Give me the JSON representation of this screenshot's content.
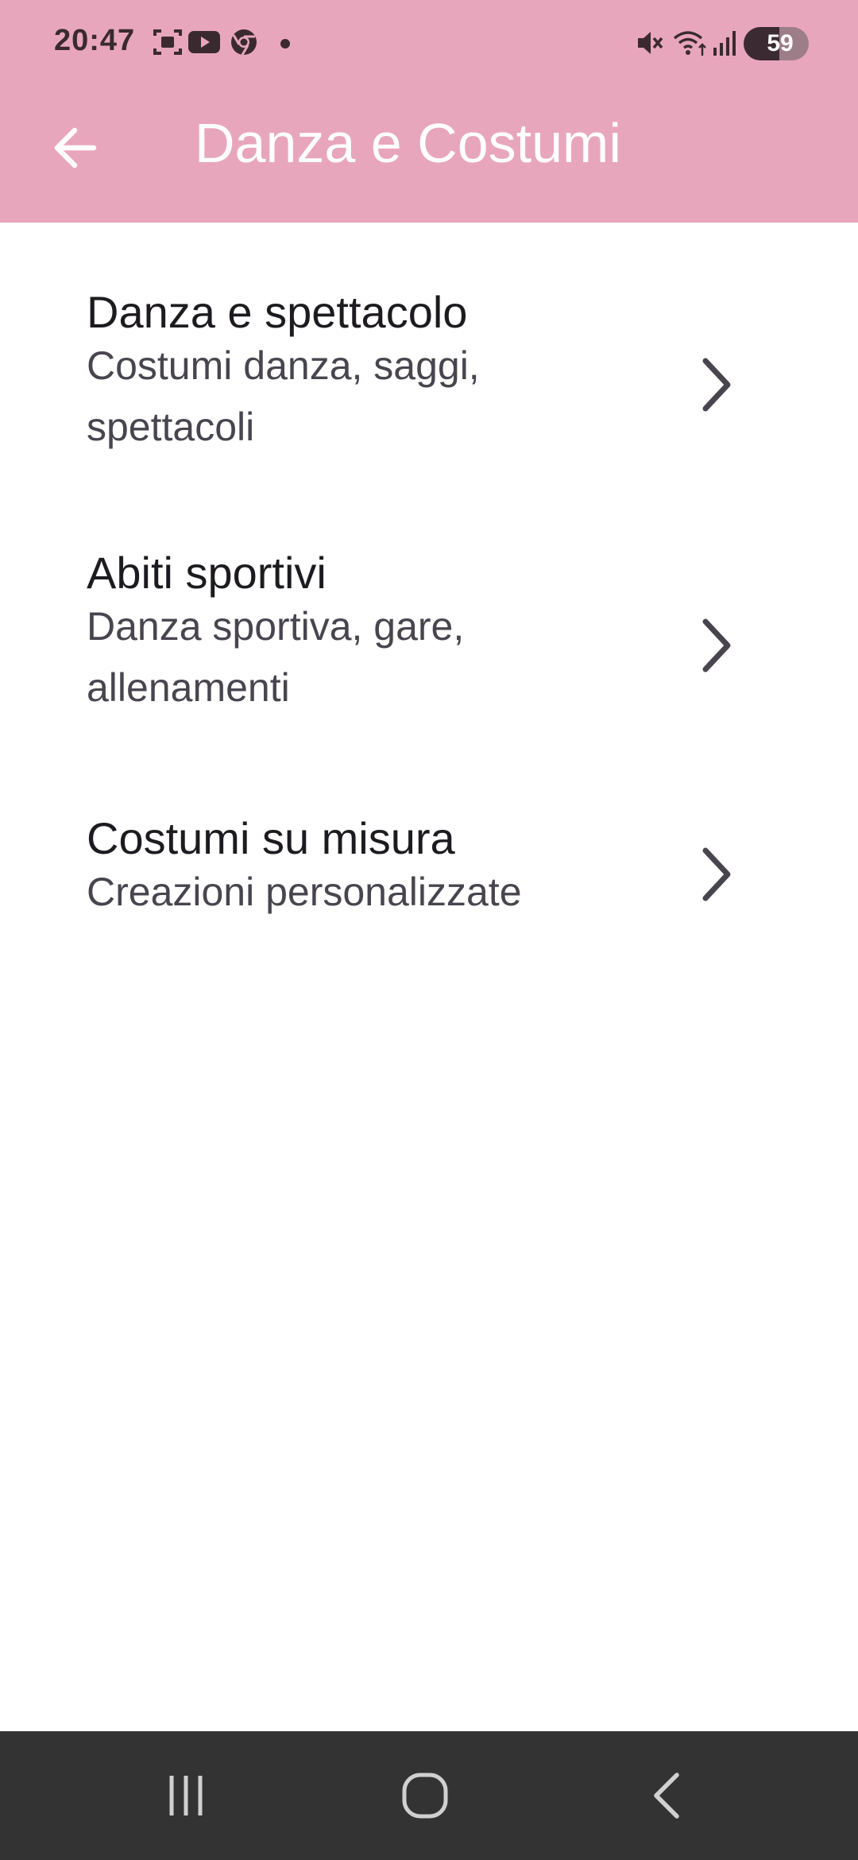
{
  "status_bar": {
    "time": "20:47",
    "battery_level": "59",
    "icons": [
      "screenshot-icon",
      "youtube-icon",
      "chrome-icon",
      "notification-dot-icon",
      "mute-icon",
      "wifi-icon",
      "signal-icon",
      "battery-charging-icon"
    ]
  },
  "app_bar": {
    "title": "Danza e Costumi",
    "back_icon": "arrow-left-icon",
    "color": "#E8A6BC"
  },
  "list": {
    "items": [
      {
        "title": "Danza e spettacolo",
        "subtitle": "Costumi danza, saggi, spettacoli",
        "icon": "chevron-right-icon"
      },
      {
        "title": "Abiti sportivi",
        "subtitle": "Danza sportiva, gare, allenamenti",
        "icon": "chevron-right-icon"
      },
      {
        "title": "Costumi su misura",
        "subtitle": "Creazioni personalizzate",
        "icon": "chevron-right-icon"
      }
    ]
  },
  "nav_bar": {
    "buttons": [
      "recents-icon",
      "home-icon",
      "back-icon"
    ]
  }
}
